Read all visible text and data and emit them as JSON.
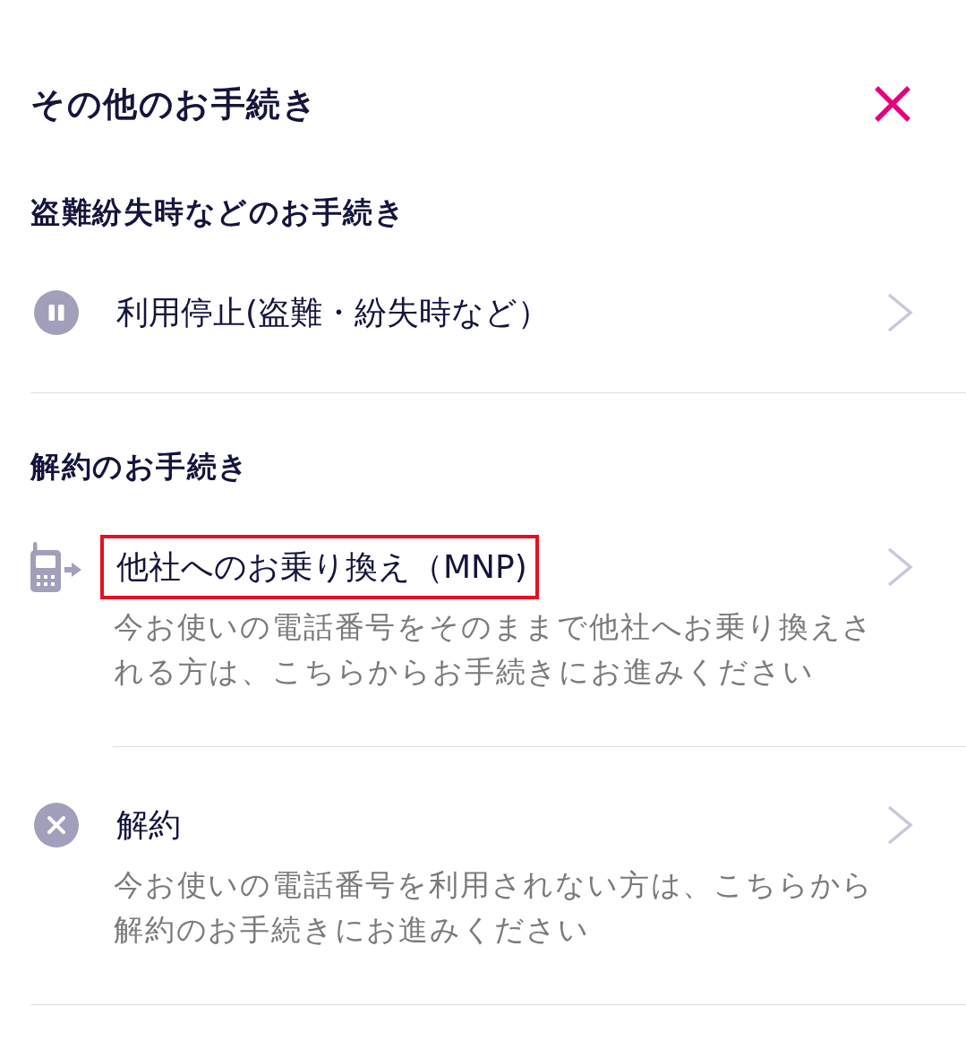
{
  "header": {
    "title": "その他のお手続き"
  },
  "sections": [
    {
      "heading": "盗難紛失時などのお手続き",
      "items": [
        {
          "kind": "suspend",
          "title": "利用停止(盗難・紛失時など）",
          "highlighted": false
        }
      ]
    },
    {
      "heading": "解約のお手続き",
      "items": [
        {
          "kind": "transfer",
          "title": "他社へのお乗り換え（MNP)",
          "highlighted": true,
          "description": "今お使いの電話番号をそのままで他社へお乗り換えされる方は、こちらからお手続きにお進みください"
        },
        {
          "kind": "cancel",
          "title": "解約",
          "highlighted": false,
          "description": "今お使いの電話番号を利用されない方は、こちらから解約のお手続きにお進みください"
        }
      ]
    }
  ]
}
